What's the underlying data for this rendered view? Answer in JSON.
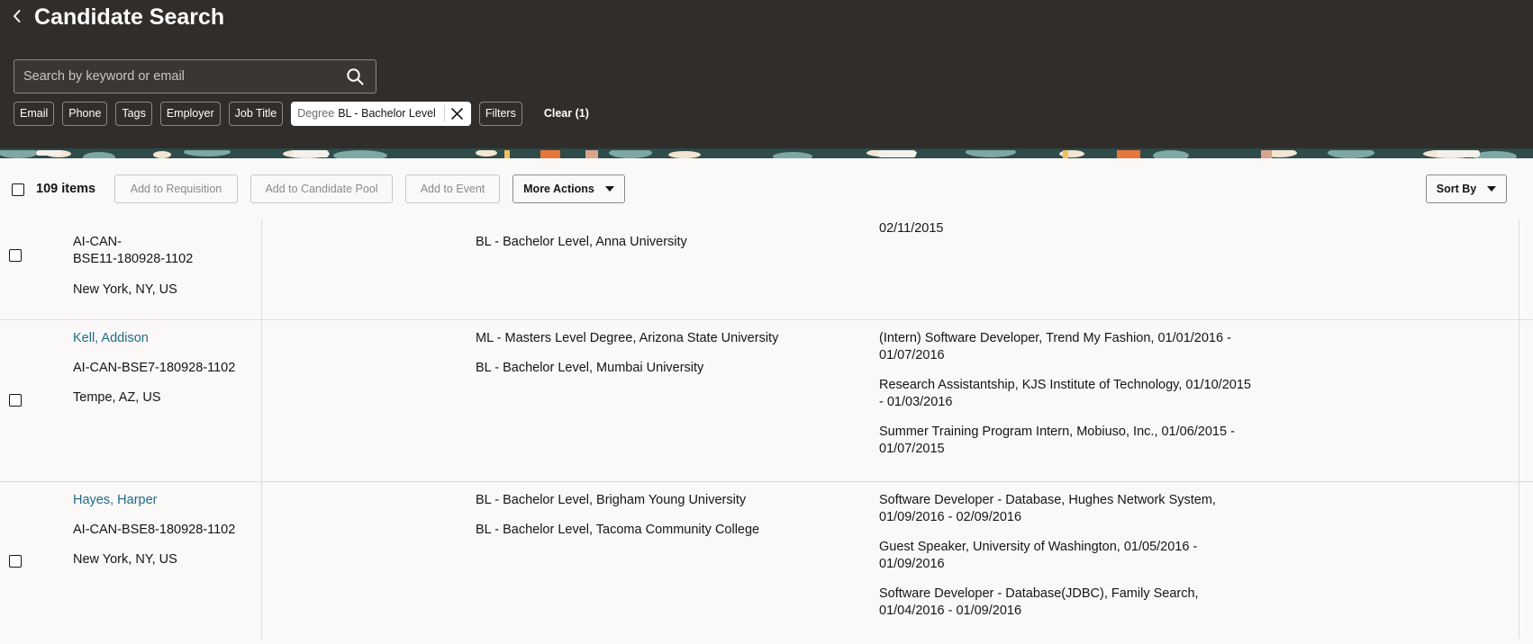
{
  "header": {
    "title": "Candidate Search",
    "search_placeholder": "Search by keyword or email",
    "filters": [
      {
        "label": "Email"
      },
      {
        "label": "Phone"
      },
      {
        "label": "Tags"
      },
      {
        "label": "Employer"
      },
      {
        "label": "Job Title"
      }
    ],
    "active_filter": {
      "label": "Degree",
      "value": "BL - Bachelor Level"
    },
    "filters_button": "Filters",
    "clear_label": "Clear (1)"
  },
  "toolbar": {
    "items_count": "109 items",
    "add_to_requisition": "Add to Requisition",
    "add_to_candidate_pool": "Add to Candidate Pool",
    "add_to_event": "Add to Event",
    "more_actions": "More Actions",
    "sort_by": "Sort By"
  },
  "candidates": [
    {
      "name": "",
      "id": "AI-CAN-\nBSE11-180928-1102",
      "id_line1": "AI-CAN-",
      "id_line2": "BSE11-180928-1102",
      "location": "New York, NY, US",
      "education": [
        "BL - Bachelor Level, Anna University"
      ],
      "experience": [
        "02/11/2015"
      ]
    },
    {
      "name": "Kell, Addison",
      "id": "AI-CAN-BSE7-180928-1102",
      "location": "Tempe, AZ, US",
      "education": [
        "ML - Masters Level Degree, Arizona State University",
        "BL - Bachelor Level, Mumbai University"
      ],
      "experience": [
        "(Intern) Software Developer, Trend My Fashion, 01/01/2016 - 01/07/2016",
        "Research Assistantship, KJS Institute of Technology, 01/10/2015 - 01/03/2016",
        "Summer Training Program Intern, Mobiuso, Inc., 01/06/2015 - 01/07/2015"
      ]
    },
    {
      "name": "Hayes, Harper",
      "id": "AI-CAN-BSE8-180928-1102",
      "location": "New York, NY, US",
      "education": [
        "BL - Bachelor Level, Brigham Young University",
        "BL - Bachelor Level, Tacoma Community College"
      ],
      "experience": [
        "Software Developer - Database, Hughes Network System, 01/09/2016 - 02/09/2016",
        "Guest Speaker, University of Washington, 01/05/2016 - 01/09/2016",
        "Software Developer - Database(JDBC), Family Search, 01/04/2016 - 01/09/2016"
      ]
    }
  ]
}
